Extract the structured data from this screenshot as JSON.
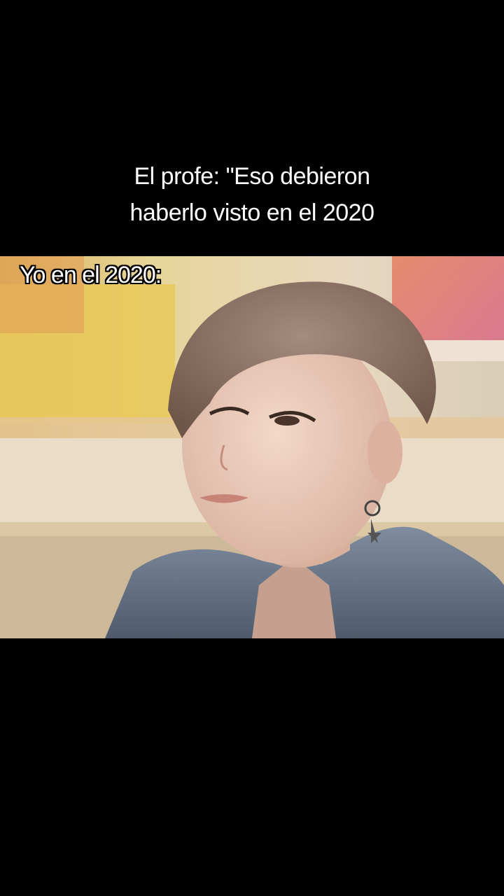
{
  "caption": {
    "line1": "El profe: \"Eso debieron",
    "line2": "haberlo visto en el 2020"
  },
  "video": {
    "overlay_text": "Yo en el 2020:",
    "image_description_icon": "portrait-photo-icon"
  },
  "colors": {
    "background": "#000000",
    "text": "#ffffff",
    "hair": "#8a7265",
    "jacket": "#6f7c90",
    "sign_yellow": "#e6cf6a",
    "sky_pink": "#e07a6a"
  }
}
